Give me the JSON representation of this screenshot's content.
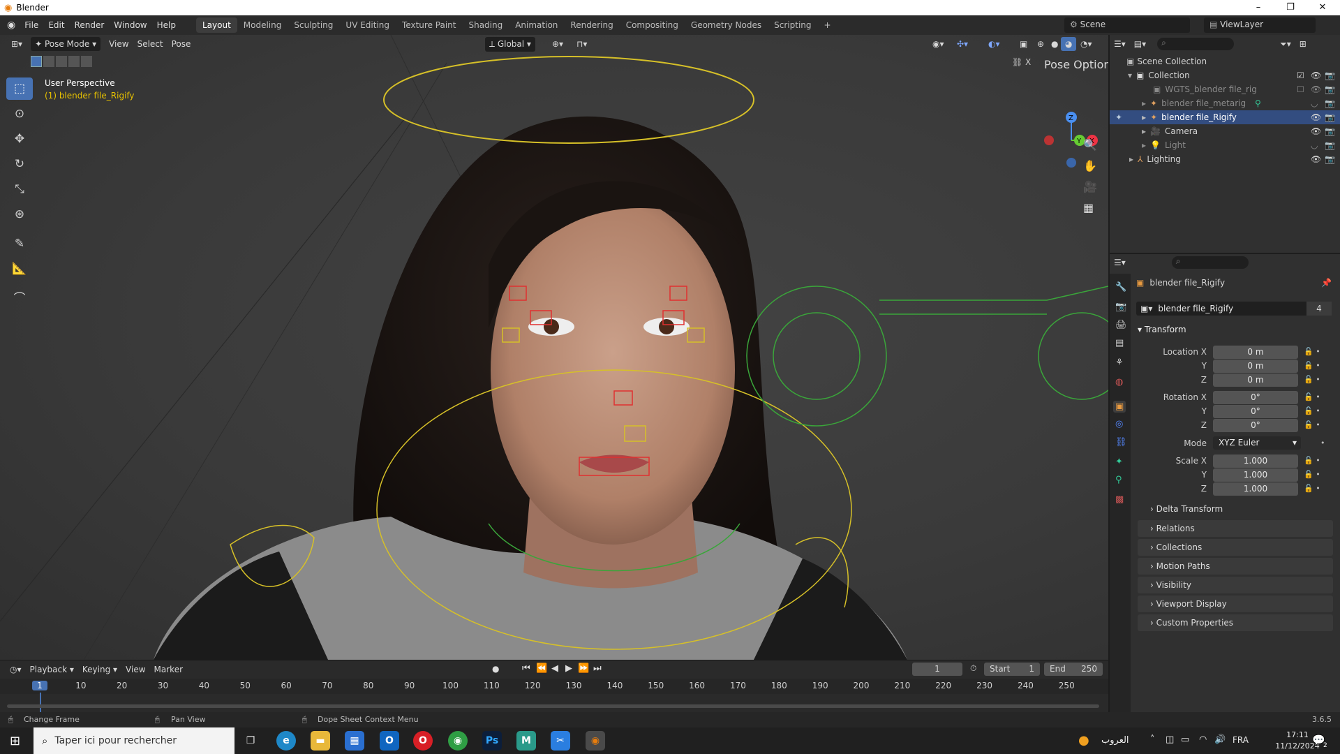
{
  "window": {
    "title": "Blender",
    "minimize": "–",
    "maximize": "❐",
    "close": "✕"
  },
  "menubar": {
    "menus": [
      "File",
      "Edit",
      "Render",
      "Window",
      "Help"
    ],
    "workspaces": [
      "Layout",
      "Modeling",
      "Sculpting",
      "UV Editing",
      "Texture Paint",
      "Shading",
      "Animation",
      "Rendering",
      "Compositing",
      "Geometry Nodes",
      "Scripting"
    ],
    "add_tab": "+",
    "scene_label": "Scene",
    "viewlayer_label": "ViewLayer"
  },
  "viewport": {
    "mode": "Pose Mode",
    "menus": [
      "View",
      "Select",
      "Pose"
    ],
    "orientation": "Global",
    "pose_options": "Pose Options",
    "overlay_title": "User Perspective",
    "overlay_object": "(1) blender file_Rigify",
    "gizmo": {
      "z": "Z",
      "y": "Y",
      "x": "X"
    }
  },
  "outliner": {
    "rows": [
      {
        "label": "Scene Collection"
      },
      {
        "label": "Collection"
      },
      {
        "label": "WGTS_blender file_rig"
      },
      {
        "label": "blender file_metarig"
      },
      {
        "label": "blender file_Rigify"
      },
      {
        "label": "Camera"
      },
      {
        "label": "Light"
      },
      {
        "label": "Lighting"
      }
    ]
  },
  "properties": {
    "object_name": "blender file_Rigify",
    "data_name": "blender file_Rigify",
    "users": "4",
    "transform_header": "Transform",
    "location": {
      "label": "Location X",
      "x": "0 m",
      "y": "0 m",
      "z": "0 m"
    },
    "rotation": {
      "label": "Rotation X",
      "x": "0°",
      "y": "0°",
      "z": "0°"
    },
    "mode_label": "Mode",
    "mode_value": "XYZ Euler",
    "scale": {
      "label": "Scale X",
      "x": "1.000",
      "y": "1.000",
      "z": "1.000"
    },
    "axis_y": "Y",
    "axis_z": "Z",
    "panels": [
      "Delta Transform",
      "Relations",
      "Collections",
      "Motion Paths",
      "Visibility",
      "Viewport Display",
      "Custom Properties"
    ]
  },
  "timeline": {
    "menus": [
      "Playback",
      "Keying",
      "View",
      "Marker"
    ],
    "current_frame": "1",
    "start_label": "Start",
    "start": "1",
    "end_label": "End",
    "end": "250",
    "ticks": [
      "1",
      "10",
      "20",
      "30",
      "40",
      "50",
      "60",
      "70",
      "80",
      "90",
      "100",
      "110",
      "120",
      "130",
      "140",
      "150",
      "160",
      "170",
      "180",
      "190",
      "200",
      "210",
      "220",
      "230",
      "240",
      "250"
    ]
  },
  "status": {
    "hint1": "Change Frame",
    "hint2": "Pan View",
    "hint3": "Dope Sheet Context Menu",
    "version": "3.6.5"
  },
  "taskbar": {
    "search_placeholder": "Taper ici pour rechercher",
    "weather": "العروب",
    "language": "FRA",
    "time": "17:11",
    "date": "11/12/2024",
    "notif": "2"
  }
}
